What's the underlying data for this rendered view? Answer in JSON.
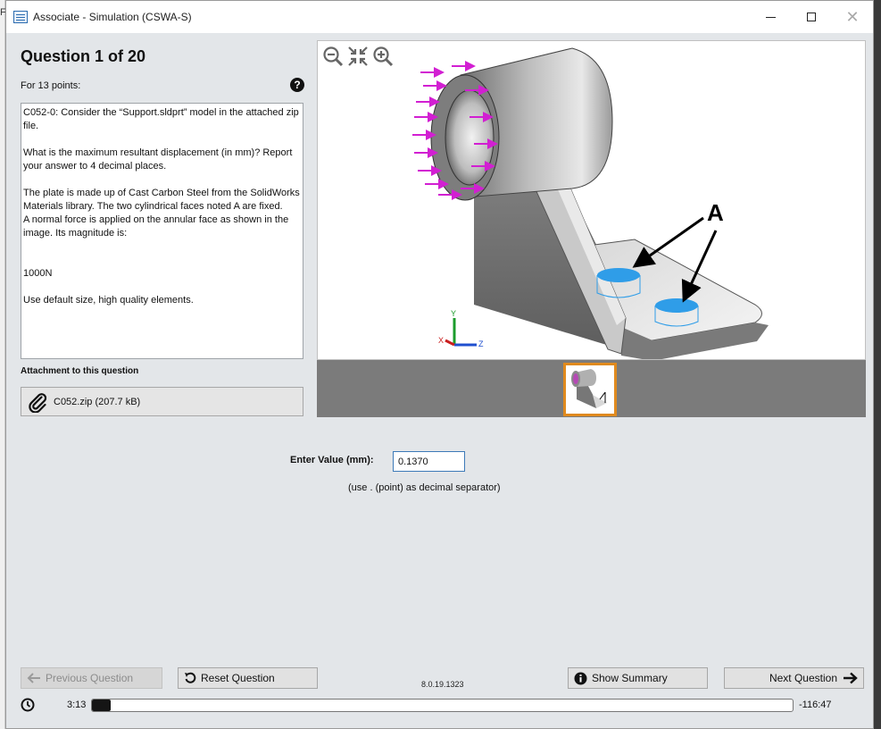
{
  "window": {
    "title": "Associate - Simulation (CSWA-S)",
    "left_edge_text": "Flo"
  },
  "question": {
    "heading": "Question 1 of 20",
    "points": "For 13 points:",
    "text": {
      "line1": "C052-0: Consider the “Support.sldprt” model in the attached zip file.",
      "line2": "What is the maximum resultant displacement (in mm)? Report your answer to 4 decimal places.",
      "line3": "The plate is made up of Cast Carbon Steel from the SolidWorks Materials library. The two cylindrical faces noted A are fixed.",
      "line4": "A normal force is applied on the annular face as shown in the image. Its magnitude is:",
      "line5": "1000N",
      "line6": "Use default size, high quality elements."
    }
  },
  "attachment": {
    "label": "Attachment to this question",
    "file": "C052.zip (207.7 kB)"
  },
  "figure": {
    "callout_label": "A",
    "axis_labels": {
      "x": "X",
      "y": "Y",
      "z": "Z"
    },
    "zoom_tools": [
      "zoom-out-icon",
      "fit-icon",
      "zoom-in-icon"
    ]
  },
  "answer": {
    "label": "Enter Value (mm):",
    "value": "0.1370",
    "note": "(use . (point) as decimal separator)"
  },
  "buttons": {
    "previous": "Previous Question",
    "reset": "Reset Question",
    "summary": "Show Summary",
    "next": "Next Question"
  },
  "version": "8.0.19.1323",
  "timer": {
    "elapsed": "3:13",
    "remaining": "-116:47",
    "progress_fraction": 0.027
  },
  "colors": {
    "accent_thumb_border": "#e08a1e",
    "force_arrows": "#d21fd2",
    "fixture": "#2f9de8",
    "window_bg": "#e3e6e9"
  }
}
